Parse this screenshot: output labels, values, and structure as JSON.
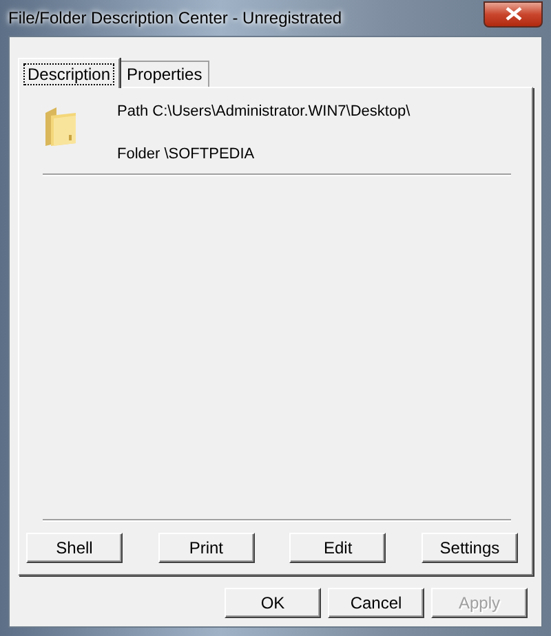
{
  "window": {
    "title": "File/Folder Description Center - Unregistrated"
  },
  "tabs": [
    {
      "label": "Description",
      "selected": true
    },
    {
      "label": "Properties",
      "selected": false
    }
  ],
  "item": {
    "path": "Path C:\\Users\\Administrator.WIN7\\Desktop\\",
    "folder": "Folder \\SOFTPEDIA"
  },
  "action_buttons": [
    {
      "label": "Shell"
    },
    {
      "label": "Print"
    },
    {
      "label": "Edit"
    },
    {
      "label": "Settings"
    }
  ],
  "dialog_buttons": [
    {
      "label": "OK",
      "disabled": false
    },
    {
      "label": "Cancel",
      "disabled": false
    },
    {
      "label": "Apply",
      "disabled": true
    }
  ]
}
